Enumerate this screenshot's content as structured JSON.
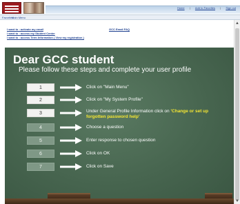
{
  "header": {
    "links": [
      "Home",
      "Add to Favorites",
      "Sign out"
    ],
    "separator": "|"
  },
  "menubar": {
    "favorites": "Favorites",
    "main_menu": "Main Menu"
  },
  "quick_links": {
    "activate_email": "I want to : activate my email",
    "access_student_center": "I want to : access my Student Center",
    "access_term_info": "I want to : access Term Information ( View my registration )",
    "email_faq": "GCC Email FAQ"
  },
  "board": {
    "title": "Dear GCC student",
    "subtitle": "Please follow these steps and complete your user profile",
    "steps": [
      {
        "num": "1",
        "text": "Click on \"Main Menu\""
      },
      {
        "num": "2",
        "text": "Click on \"My System Profile\""
      },
      {
        "num": "3",
        "text_before": "Under General Profile Information click on",
        "highlight": "'Change or set up forgotten password help'"
      },
      {
        "num": "4",
        "text": "Choose a question"
      },
      {
        "num": "5",
        "text": "Enter response to chosen question"
      },
      {
        "num": "6",
        "text": "Click on OK"
      },
      {
        "num": "7",
        "text": "Click on Save"
      }
    ]
  },
  "colors": {
    "board": "#47654f",
    "highlight": "#f5e633",
    "link": "#1d3f8f"
  },
  "icons": {
    "arrow": "right-arrow-icon",
    "scroll_up": "chevron-up-icon",
    "scroll_down": "chevron-down-icon"
  }
}
